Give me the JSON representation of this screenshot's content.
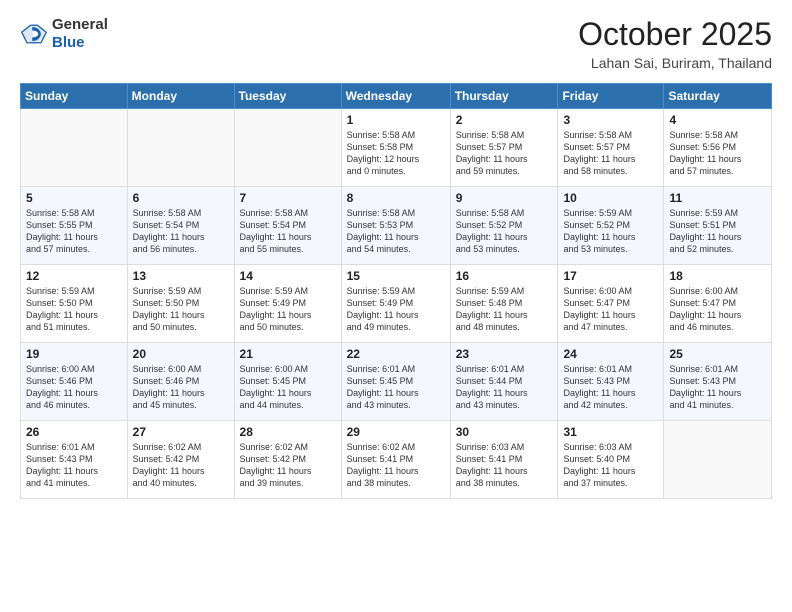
{
  "header": {
    "logo_general": "General",
    "logo_blue": "Blue",
    "month": "October 2025",
    "location": "Lahan Sai, Buriram, Thailand"
  },
  "weekdays": [
    "Sunday",
    "Monday",
    "Tuesday",
    "Wednesday",
    "Thursday",
    "Friday",
    "Saturday"
  ],
  "weeks": [
    [
      {
        "day": "",
        "info": ""
      },
      {
        "day": "",
        "info": ""
      },
      {
        "day": "",
        "info": ""
      },
      {
        "day": "1",
        "info": "Sunrise: 5:58 AM\nSunset: 5:58 PM\nDaylight: 12 hours\nand 0 minutes."
      },
      {
        "day": "2",
        "info": "Sunrise: 5:58 AM\nSunset: 5:57 PM\nDaylight: 11 hours\nand 59 minutes."
      },
      {
        "day": "3",
        "info": "Sunrise: 5:58 AM\nSunset: 5:57 PM\nDaylight: 11 hours\nand 58 minutes."
      },
      {
        "day": "4",
        "info": "Sunrise: 5:58 AM\nSunset: 5:56 PM\nDaylight: 11 hours\nand 57 minutes."
      }
    ],
    [
      {
        "day": "5",
        "info": "Sunrise: 5:58 AM\nSunset: 5:55 PM\nDaylight: 11 hours\nand 57 minutes."
      },
      {
        "day": "6",
        "info": "Sunrise: 5:58 AM\nSunset: 5:54 PM\nDaylight: 11 hours\nand 56 minutes."
      },
      {
        "day": "7",
        "info": "Sunrise: 5:58 AM\nSunset: 5:54 PM\nDaylight: 11 hours\nand 55 minutes."
      },
      {
        "day": "8",
        "info": "Sunrise: 5:58 AM\nSunset: 5:53 PM\nDaylight: 11 hours\nand 54 minutes."
      },
      {
        "day": "9",
        "info": "Sunrise: 5:58 AM\nSunset: 5:52 PM\nDaylight: 11 hours\nand 53 minutes."
      },
      {
        "day": "10",
        "info": "Sunrise: 5:59 AM\nSunset: 5:52 PM\nDaylight: 11 hours\nand 53 minutes."
      },
      {
        "day": "11",
        "info": "Sunrise: 5:59 AM\nSunset: 5:51 PM\nDaylight: 11 hours\nand 52 minutes."
      }
    ],
    [
      {
        "day": "12",
        "info": "Sunrise: 5:59 AM\nSunset: 5:50 PM\nDaylight: 11 hours\nand 51 minutes."
      },
      {
        "day": "13",
        "info": "Sunrise: 5:59 AM\nSunset: 5:50 PM\nDaylight: 11 hours\nand 50 minutes."
      },
      {
        "day": "14",
        "info": "Sunrise: 5:59 AM\nSunset: 5:49 PM\nDaylight: 11 hours\nand 50 minutes."
      },
      {
        "day": "15",
        "info": "Sunrise: 5:59 AM\nSunset: 5:49 PM\nDaylight: 11 hours\nand 49 minutes."
      },
      {
        "day": "16",
        "info": "Sunrise: 5:59 AM\nSunset: 5:48 PM\nDaylight: 11 hours\nand 48 minutes."
      },
      {
        "day": "17",
        "info": "Sunrise: 6:00 AM\nSunset: 5:47 PM\nDaylight: 11 hours\nand 47 minutes."
      },
      {
        "day": "18",
        "info": "Sunrise: 6:00 AM\nSunset: 5:47 PM\nDaylight: 11 hours\nand 46 minutes."
      }
    ],
    [
      {
        "day": "19",
        "info": "Sunrise: 6:00 AM\nSunset: 5:46 PM\nDaylight: 11 hours\nand 46 minutes."
      },
      {
        "day": "20",
        "info": "Sunrise: 6:00 AM\nSunset: 5:46 PM\nDaylight: 11 hours\nand 45 minutes."
      },
      {
        "day": "21",
        "info": "Sunrise: 6:00 AM\nSunset: 5:45 PM\nDaylight: 11 hours\nand 44 minutes."
      },
      {
        "day": "22",
        "info": "Sunrise: 6:01 AM\nSunset: 5:45 PM\nDaylight: 11 hours\nand 43 minutes."
      },
      {
        "day": "23",
        "info": "Sunrise: 6:01 AM\nSunset: 5:44 PM\nDaylight: 11 hours\nand 43 minutes."
      },
      {
        "day": "24",
        "info": "Sunrise: 6:01 AM\nSunset: 5:43 PM\nDaylight: 11 hours\nand 42 minutes."
      },
      {
        "day": "25",
        "info": "Sunrise: 6:01 AM\nSunset: 5:43 PM\nDaylight: 11 hours\nand 41 minutes."
      }
    ],
    [
      {
        "day": "26",
        "info": "Sunrise: 6:01 AM\nSunset: 5:43 PM\nDaylight: 11 hours\nand 41 minutes."
      },
      {
        "day": "27",
        "info": "Sunrise: 6:02 AM\nSunset: 5:42 PM\nDaylight: 11 hours\nand 40 minutes."
      },
      {
        "day": "28",
        "info": "Sunrise: 6:02 AM\nSunset: 5:42 PM\nDaylight: 11 hours\nand 39 minutes."
      },
      {
        "day": "29",
        "info": "Sunrise: 6:02 AM\nSunset: 5:41 PM\nDaylight: 11 hours\nand 38 minutes."
      },
      {
        "day": "30",
        "info": "Sunrise: 6:03 AM\nSunset: 5:41 PM\nDaylight: 11 hours\nand 38 minutes."
      },
      {
        "day": "31",
        "info": "Sunrise: 6:03 AM\nSunset: 5:40 PM\nDaylight: 11 hours\nand 37 minutes."
      },
      {
        "day": "",
        "info": ""
      }
    ]
  ]
}
